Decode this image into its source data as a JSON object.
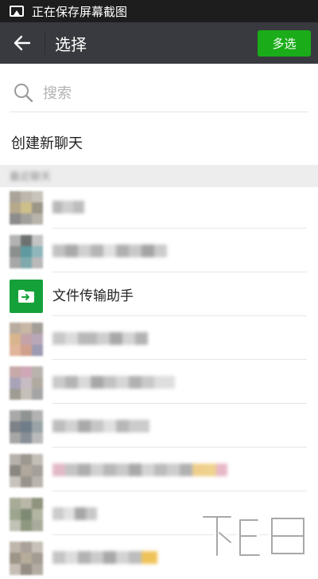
{
  "status_bar": {
    "text": "正在保存屏幕截图",
    "icon": "image-icon"
  },
  "app_bar": {
    "title": "选择",
    "back_icon": "arrow-left-icon",
    "multi_select_label": "多选",
    "accent": "#1aad19"
  },
  "search": {
    "placeholder": "搜索",
    "icon": "search-icon"
  },
  "new_chat_label": "创建新聊天",
  "section_header": "最近聊天",
  "file_helper": {
    "name": "文件传输助手",
    "icon": "folder-arrow-icon",
    "color": "#15a13a"
  },
  "watermark": {
    "brand": "下载吧"
  },
  "colors": {
    "app_bar_bg": "#393a3f",
    "status_bar_bg": "#1d1d1d"
  }
}
